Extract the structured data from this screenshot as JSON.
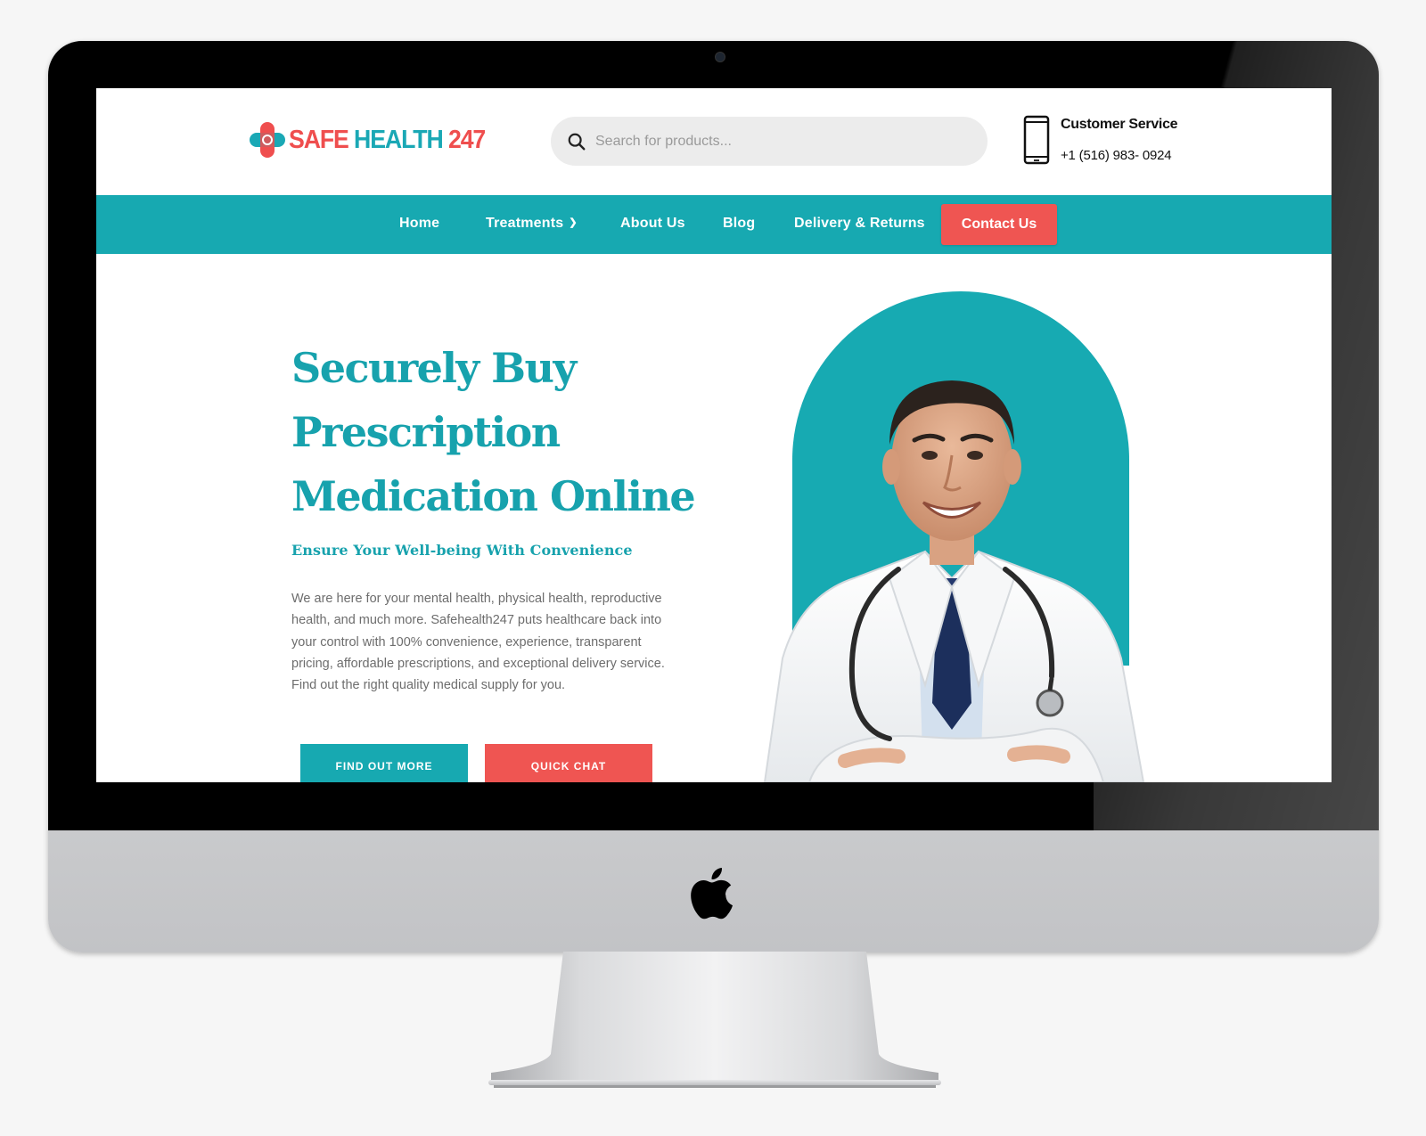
{
  "header": {
    "logo": {
      "part1": "SAFE",
      "part2": "HEALTH",
      "part3": "247"
    },
    "search": {
      "placeholder": "Search for products..."
    },
    "customer_service": {
      "title": "Customer Service",
      "phone": "+1 (516) 983- 0924"
    }
  },
  "nav": {
    "items": [
      {
        "label": "Home"
      },
      {
        "label": "Treatments",
        "has_dropdown": true
      },
      {
        "label": "About Us"
      },
      {
        "label": "Blog"
      },
      {
        "label": "Delivery & Returns"
      }
    ],
    "cta": "Contact Us"
  },
  "hero": {
    "title_line1": "Securely Buy",
    "title_line2": "Prescription",
    "title_line3": "Medication Online",
    "subtitle": "Ensure Your Well-being With Convenience",
    "body": "We are here for your mental health, physical health, reproductive health, and much more. Safehealth247 puts healthcare back into your control with 100% convenience, experience, transparent pricing, affordable prescriptions, and exceptional delivery service. Find out the right quality medical supply for you.",
    "btn_primary": "FIND OUT MORE",
    "btn_secondary": "QUICK CHAT"
  },
  "colors": {
    "teal": "#17a9b1",
    "coral": "#ef5552",
    "bezel": "#000000",
    "chin": "#c4c5c8"
  },
  "icons": [
    "search-icon",
    "phone-icon",
    "chevron-down-icon",
    "apple-logo-icon"
  ]
}
